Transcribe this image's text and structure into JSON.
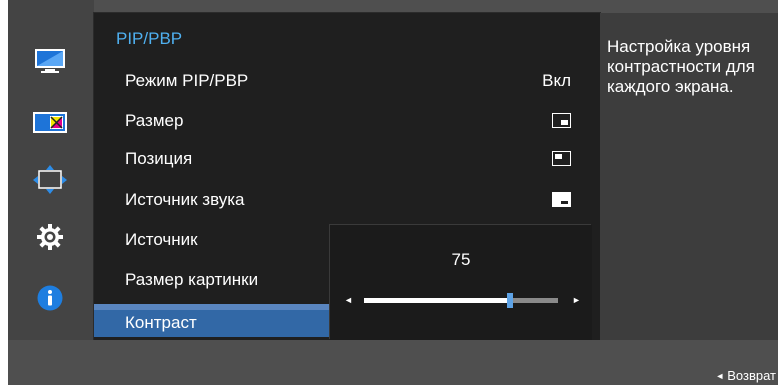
{
  "menu": {
    "title": "PIP/PBP",
    "items": [
      {
        "label": "Режим PIP/PBP",
        "value": "Вкл"
      },
      {
        "label": "Размер"
      },
      {
        "label": "Позиция"
      },
      {
        "label": "Источник звука"
      },
      {
        "label": "Источник"
      },
      {
        "label": "Размер картинки"
      },
      {
        "label": "Контраст",
        "selected": true
      }
    ]
  },
  "sidebar": {
    "icons": [
      "monitor-icon",
      "color-icon",
      "size-position-icon",
      "settings-gear-icon",
      "info-icon"
    ],
    "active_index": 1
  },
  "slider": {
    "value": "75",
    "level": 0.75
  },
  "help": {
    "text": "Настройка уровня контрастности для каждого экрана."
  },
  "footer": {
    "back_label": "Возврат"
  },
  "colors": {
    "accent_title": "#4fb0f0",
    "selected_bg": "#3268a6",
    "slider_thumb": "#5ea3e6"
  }
}
